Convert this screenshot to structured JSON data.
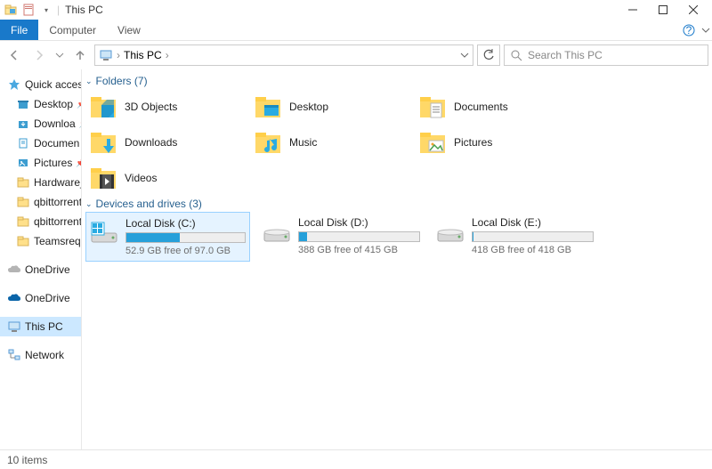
{
  "window": {
    "title": "This PC"
  },
  "ribbon": {
    "file": "File",
    "computer": "Computer",
    "view": "View"
  },
  "breadcrumb": {
    "location": "This PC",
    "dropdown_placeholder": ""
  },
  "search": {
    "placeholder": "Search This PC"
  },
  "sidebar": {
    "quick_access": "Quick access",
    "items": [
      {
        "label": "Desktop",
        "pinned": true
      },
      {
        "label": "Downloa",
        "pinned": true
      },
      {
        "label": "Documen",
        "pinned": true
      },
      {
        "label": "Pictures",
        "pinned": true
      },
      {
        "label": "Hardware_fi",
        "pinned": false
      },
      {
        "label": "qbittorrent_t",
        "pinned": false
      },
      {
        "label": "qbittorrent_t",
        "pinned": false
      },
      {
        "label": "Teamsreque",
        "pinned": false
      }
    ],
    "onedrive1": "OneDrive",
    "onedrive2": "OneDrive",
    "thispc": "This PC",
    "network": "Network"
  },
  "groups": {
    "folders": {
      "label": "Folders (7)"
    },
    "drives": {
      "label": "Devices and drives (3)"
    }
  },
  "folders": [
    {
      "label": "3D Objects"
    },
    {
      "label": "Desktop"
    },
    {
      "label": "Documents"
    },
    {
      "label": "Downloads"
    },
    {
      "label": "Music"
    },
    {
      "label": "Pictures"
    },
    {
      "label": "Videos"
    }
  ],
  "drives": [
    {
      "name": "Local Disk (C:)",
      "free_text": "52.9 GB free of 97.0 GB",
      "fill_pct": 45,
      "selected": true
    },
    {
      "name": "Local Disk (D:)",
      "free_text": "388 GB free of 415 GB",
      "fill_pct": 7,
      "selected": false
    },
    {
      "name": "Local Disk (E:)",
      "free_text": "418 GB free of 418 GB",
      "fill_pct": 1,
      "selected": false
    }
  ],
  "status": {
    "text": "10 items"
  }
}
